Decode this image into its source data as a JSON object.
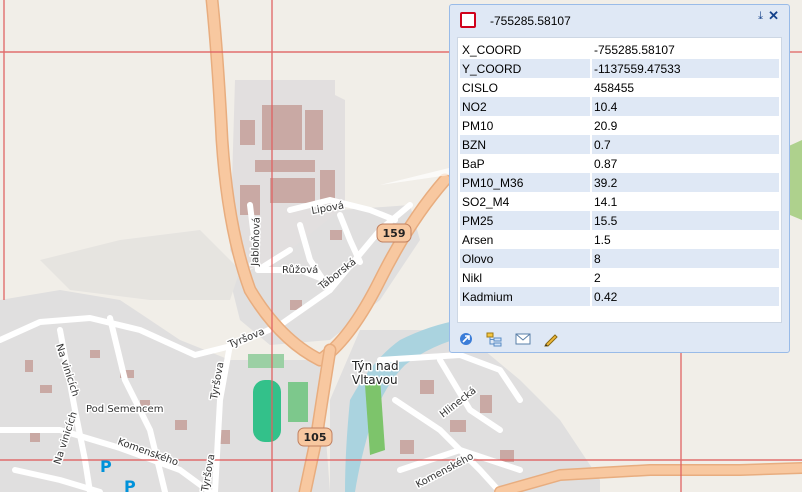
{
  "map": {
    "labels": {
      "lipova": "Lipová",
      "jablonova": "Jabloňová",
      "ruzova": "Růžová",
      "taborska": "Táborská",
      "tyrsova1": "Tyršova",
      "tyrsova2": "Tyršova",
      "tyrsova3": "Tyršova",
      "na_vinicich1": "Na vinicích",
      "na_vinicich2": "Na vinicích",
      "pod_semencem": "Pod Semencem",
      "komenskeho1": "Komenského",
      "komenskeho2": "Komenského",
      "hlinecka": "Hlinecká",
      "town": [
        "Týn nad",
        "Vltavou"
      ],
      "route_159": "159",
      "route_105": "105",
      "parking": "P"
    }
  },
  "popup": {
    "title": "-755285.58107",
    "attributes": [
      {
        "key": "X_COORD",
        "value": "-755285.58107"
      },
      {
        "key": "Y_COORD",
        "value": "-1137559.47533"
      },
      {
        "key": "CISLO",
        "value": "458455"
      },
      {
        "key": "NO2",
        "value": "10.4"
      },
      {
        "key": "PM10",
        "value": "20.9"
      },
      {
        "key": "BZN",
        "value": "0.7"
      },
      {
        "key": "BaP",
        "value": "0.87"
      },
      {
        "key": "PM10_M36",
        "value": "39.2"
      },
      {
        "key": "SO2_M4",
        "value": "14.1"
      },
      {
        "key": "PM25",
        "value": "15.5"
      },
      {
        "key": "Arsen",
        "value": "1.5"
      },
      {
        "key": "Olovo",
        "value": "8"
      },
      {
        "key": "Nikl",
        "value": "2"
      },
      {
        "key": "Kadmium",
        "value": "0.42"
      }
    ],
    "tools": [
      "zoom-to-icon",
      "select-features-icon",
      "email-icon",
      "edit-pencil-icon"
    ]
  },
  "colors": {
    "grid": "#e06060",
    "main_road": "#f8c8a0",
    "road_outline": "#e8ad7f",
    "residential": "#e0dfdf",
    "building": "#c9a9a4",
    "popup_bg": "#dfe8f5",
    "popup_border": "#99bbe8",
    "symbol": "#d0021b"
  }
}
